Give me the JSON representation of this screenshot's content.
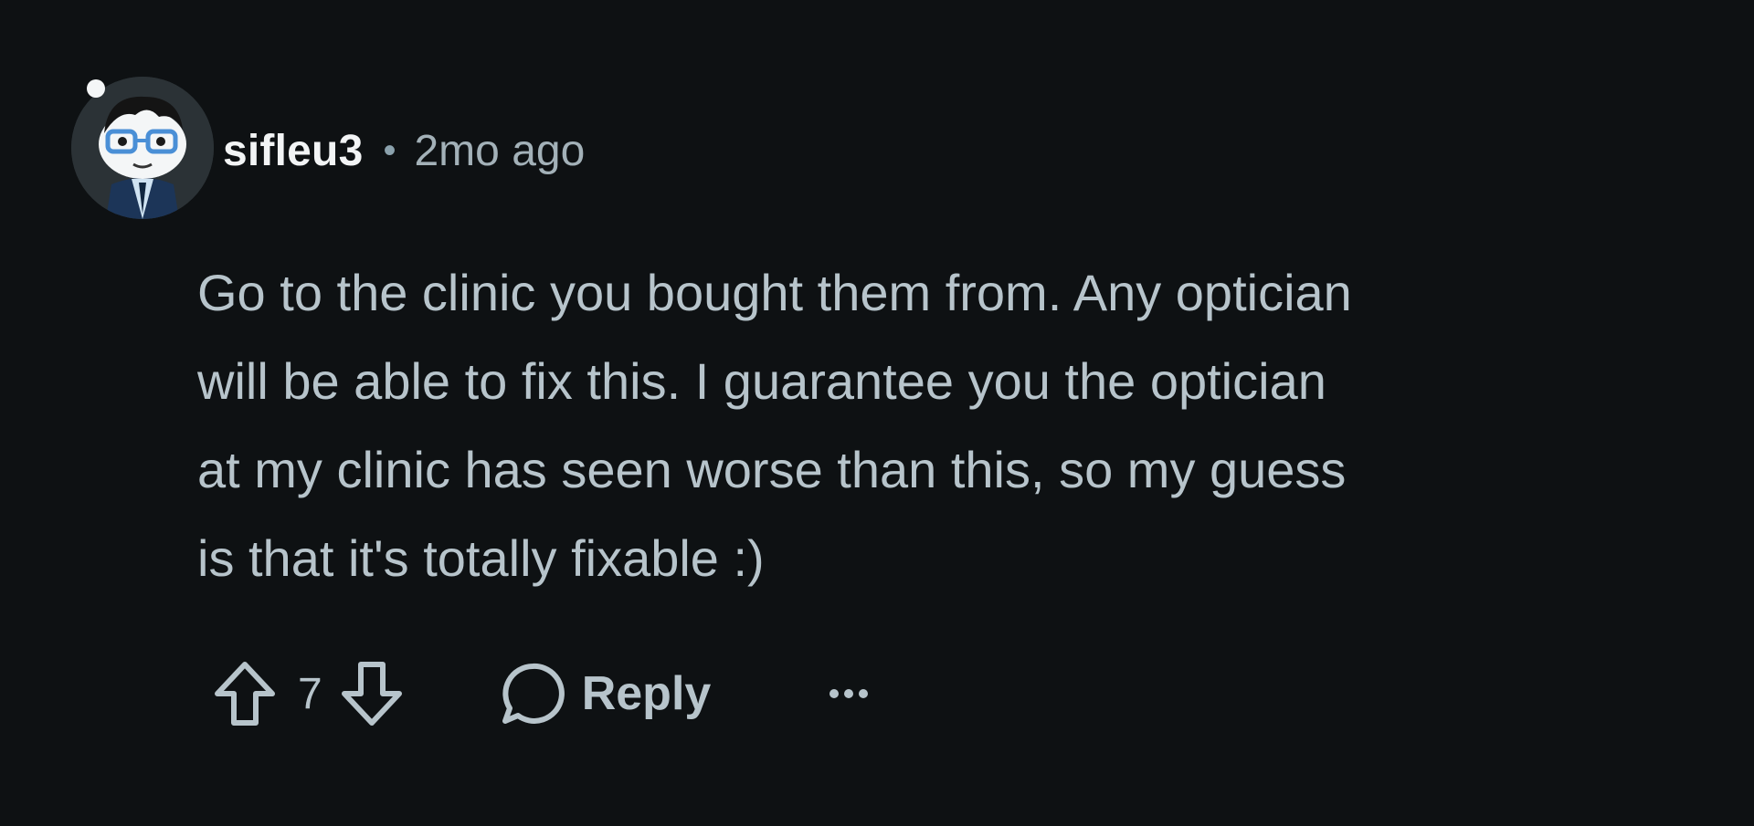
{
  "comment": {
    "author": "sifleu3",
    "separator": "•",
    "timestamp": "2mo ago",
    "body": "Go to the clinic you bought them from. Any optician\nwill be able to fix this. I guarantee you the optician\nat my clinic has seen worse than this, so my guess\nis that it's totally fixable :)",
    "votes": "7",
    "reply_label": "Reply"
  },
  "icons": {
    "upvote": "upvote-arrow-icon",
    "downvote": "downvote-arrow-icon",
    "reply": "speech-bubble-icon",
    "more": "ellipsis-icon"
  },
  "colors": {
    "background": "#0e1113",
    "username": "#f2f4f5",
    "text": "#b7c4cb",
    "muted": "#a3b1b8"
  }
}
